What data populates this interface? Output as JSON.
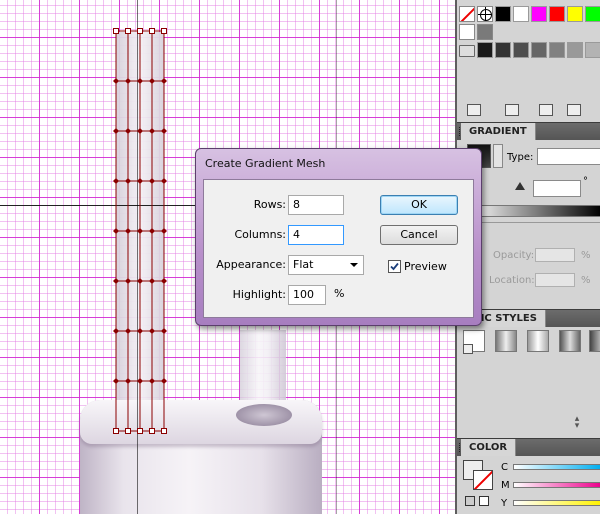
{
  "dialog": {
    "title": "Create Gradient Mesh",
    "rows_label": "Rows:",
    "rows_value": "8",
    "columns_label": "Columns:",
    "columns_value": "4",
    "appearance_label": "Appearance:",
    "appearance_value": "Flat",
    "highlight_label": "Highlight:",
    "highlight_value": "100",
    "highlight_unit": "%",
    "ok_label": "OK",
    "cancel_label": "Cancel",
    "preview_label": "Preview",
    "preview_checked": true
  },
  "swatches": {
    "colors": [
      "#000000",
      "#ffffff",
      "#ff00ff",
      "#ff0000",
      "#ffff00",
      "#00ff00"
    ],
    "grays": [
      "#1a1a1a",
      "#333333",
      "#4d4d4d",
      "#666666",
      "#808080",
      "#999999",
      "#b3b3b3"
    ]
  },
  "gradient_panel": {
    "tab": "GRADIENT",
    "type_label": "Type:",
    "angle_unit": "°",
    "opacity_label": "Opacity:",
    "opacity_unit": "%",
    "location_label": "Location:",
    "location_unit": "%"
  },
  "graphic_styles_panel": {
    "tab": "PHIC STYLES"
  },
  "color_panel": {
    "tab": "COLOR",
    "c_label": "C",
    "m_label": "M",
    "y_label": "Y"
  },
  "mesh": {
    "rows": 8,
    "columns": 4,
    "color": "#8b0000"
  }
}
